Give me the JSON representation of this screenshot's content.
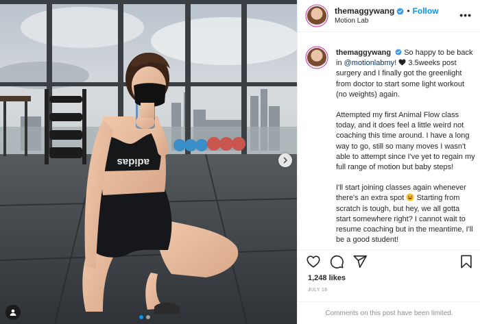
{
  "post": {
    "username": "themaggywang",
    "follow_label": "Follow",
    "separator": "•",
    "location": "Motion Lab",
    "more_label": "•••",
    "caption": {
      "line1_before_mention": "So happy to be back in ",
      "mention": "@motionlabmy",
      "line1_after_mention": "! ",
      "line1_tail": " 3.5weeks post surgery and I finally got the greenlight from doctor to start some light workout (no weights) again.",
      "paragraph2": "Attempted my first Animal Flow class today, and it does feel a little weird not coaching this time around. I have a long way to go, still so many moves I wasn't able to attempt since I've yet to regain my full range of motion but baby steps!",
      "paragraph3_before_emoji": "I'll start joining classes again whenever there's an extra spot ",
      "paragraph3_after_emoji": " Starting from scratch is tough, but hey, we all gotta start somewhere right? I cannot wait to resume coaching but in the meantime, I'll be a good student!"
    },
    "likes": "1,248 likes",
    "date": "JULY 18",
    "comments_notice": "Comments on this post have been limited.",
    "photo_brand_text": "adidas",
    "carousel_index": 1,
    "carousel_count": 2
  },
  "colors": {
    "link_blue": "#0095f6",
    "mention": "#00376b",
    "muted": "#8e8e8e",
    "text": "#262626"
  },
  "icons": {
    "verified": "verified-badge-icon",
    "like": "heart-icon",
    "comment": "comment-icon",
    "share": "share-icon",
    "save": "bookmark-icon",
    "next": "chevron-right-icon",
    "tags": "user-tag-icon"
  }
}
